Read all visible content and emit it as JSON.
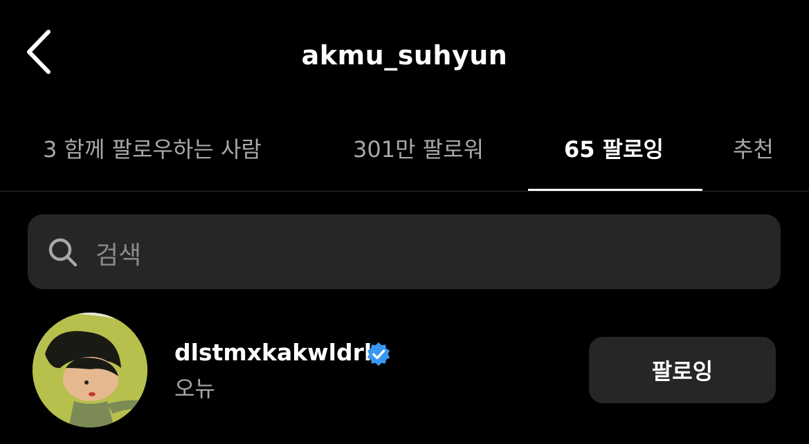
{
  "header": {
    "back_icon": "chevron-left-icon",
    "title": "akmu_suhyun"
  },
  "tabs": [
    {
      "label": "3 함께 팔로우하는 사람",
      "active": false
    },
    {
      "label": "301만 팔로워",
      "active": false
    },
    {
      "label": "65 팔로잉",
      "active": true
    },
    {
      "label": "추천",
      "active": false
    }
  ],
  "search": {
    "icon": "search-icon",
    "placeholder": "검색"
  },
  "users": [
    {
      "username": "dlstmxkakwldrl",
      "verified": true,
      "verified_color": "#3897f0",
      "subname": "오뉴",
      "button_label": "팔로잉"
    }
  ],
  "colors": {
    "background": "#000000",
    "surface": "#262626",
    "muted_text": "#a8a8a8"
  }
}
